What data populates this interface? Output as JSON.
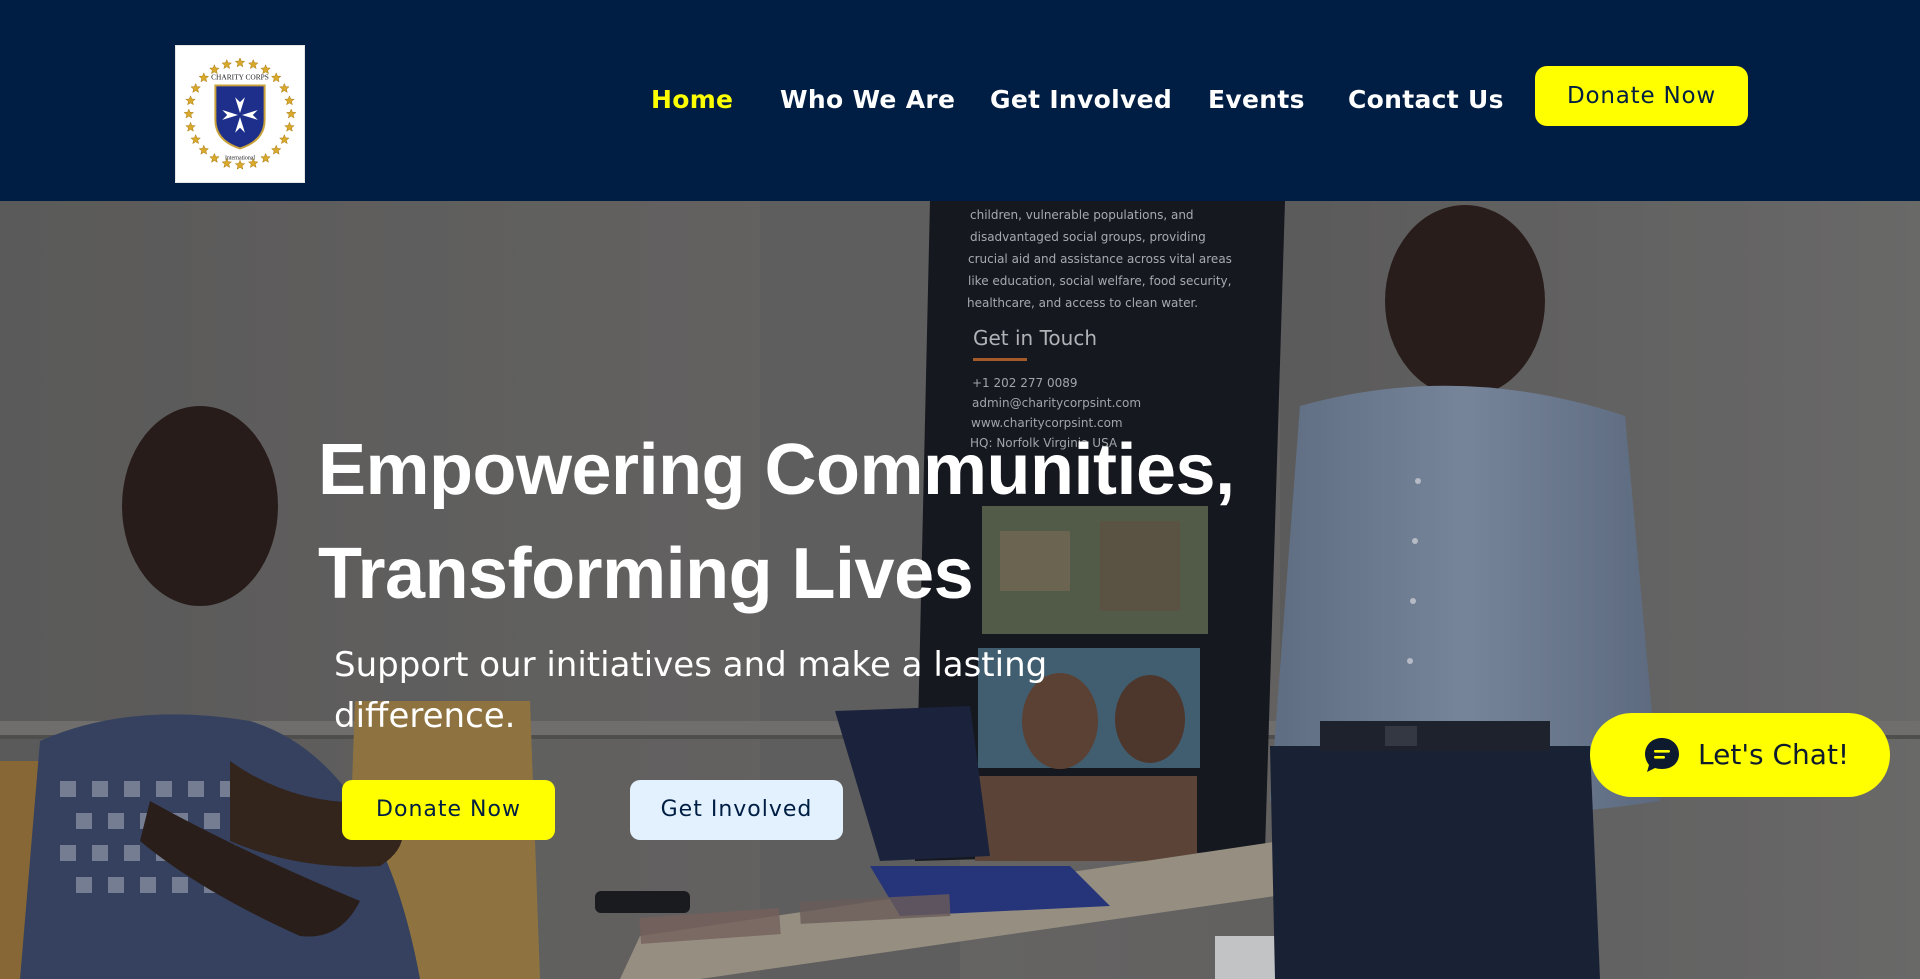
{
  "logo": {
    "top_text": "CHARITY CORPS",
    "bottom_text": "International"
  },
  "nav": {
    "items": [
      {
        "label": "Home",
        "active": true
      },
      {
        "label": "Who We Are",
        "active": false
      },
      {
        "label": "Get Involved",
        "active": false
      },
      {
        "label": "Events",
        "active": false
      },
      {
        "label": "Contact Us",
        "active": false
      }
    ],
    "donate_label": "Donate Now"
  },
  "hero": {
    "title_line1": "Empowering Communities,",
    "title_line2": "Transforming Lives",
    "subtitle": "Support our initiatives and make a lasting difference.",
    "donate_label": "Donate Now",
    "involved_label": "Get Involved"
  },
  "banner": {
    "body_lines": [
      "children, vulnerable populations, and",
      "disadvantaged social groups, providing",
      "crucial aid and assistance across vital areas",
      "like education, social welfare, food security,",
      "healthcare, and access to clean water."
    ],
    "contact_heading": "Get in Touch",
    "contact_lines": [
      "+1 202 277 0089",
      "admin@charitycorpsint.com",
      "www.charitycorpsint.com",
      "HQ: Norfolk Virginia USA"
    ]
  },
  "chat": {
    "label": "Let's Chat!"
  },
  "colors": {
    "header_bg": "#001d43",
    "accent": "#ffff00",
    "secondary_button": "#e2f1fd",
    "text_on_dark": "#ffffff"
  },
  "icons": {
    "chat": "chat-bubble-icon",
    "logo_emblem": "maltese-cross-shield-icon"
  }
}
